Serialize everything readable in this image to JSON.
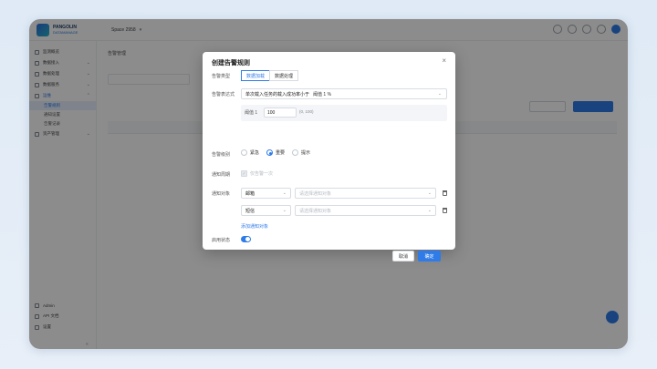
{
  "app": {
    "logo_line1": "PANGOLIN",
    "logo_line2": "DATAMANAGE",
    "workspace": "Space 2958",
    "workspace_caret": "▾",
    "breadcrumb": "告警管理"
  },
  "sidebar": {
    "items": [
      {
        "label": "监测概览"
      },
      {
        "label": "数据接入"
      },
      {
        "label": "数据处理"
      },
      {
        "label": "数据服务"
      },
      {
        "label": "运维"
      },
      {
        "label": "资产管理"
      }
    ],
    "sub_items": [
      {
        "label": "告警规则",
        "active": true
      },
      {
        "label": "通知设置"
      },
      {
        "label": "告警记录"
      }
    ],
    "bottom_items": [
      {
        "label": "Admin"
      },
      {
        "label": "API 文档"
      },
      {
        "label": "设置"
      }
    ]
  },
  "modal": {
    "title": "创建告警规则",
    "close": "×",
    "labels": {
      "type": "告警类型",
      "expression": "告警表达式",
      "level": "告警级别",
      "cycle": "通知周期",
      "targets": "通知对象",
      "status": "启用状态"
    },
    "tabs": [
      {
        "label": "数据加载",
        "active": true
      },
      {
        "label": "数据处理",
        "active": false
      }
    ],
    "expression": {
      "value": "单次载入任务的载入成功率小于",
      "extra": "阈值 1  %",
      "threshold_label": "阈值 1",
      "threshold_value": "100",
      "range": "(0, 100)"
    },
    "levels": [
      {
        "label": "紧急",
        "checked": false
      },
      {
        "label": "重要",
        "checked": true
      },
      {
        "label": "提示",
        "checked": false
      }
    ],
    "cycle_checkbox": "仅告警一次",
    "targets": [
      {
        "type": "邮箱",
        "placeholder": "请选择通知对象"
      },
      {
        "type": "短信",
        "placeholder": "请选择通知对象"
      }
    ],
    "add_target": "添加通知对象",
    "toggle_on": true,
    "cancel": "取消",
    "ok": "确定"
  },
  "colors": {
    "accent": "#2f7be8",
    "overlay": "rgba(0,0,0,0.45)"
  }
}
